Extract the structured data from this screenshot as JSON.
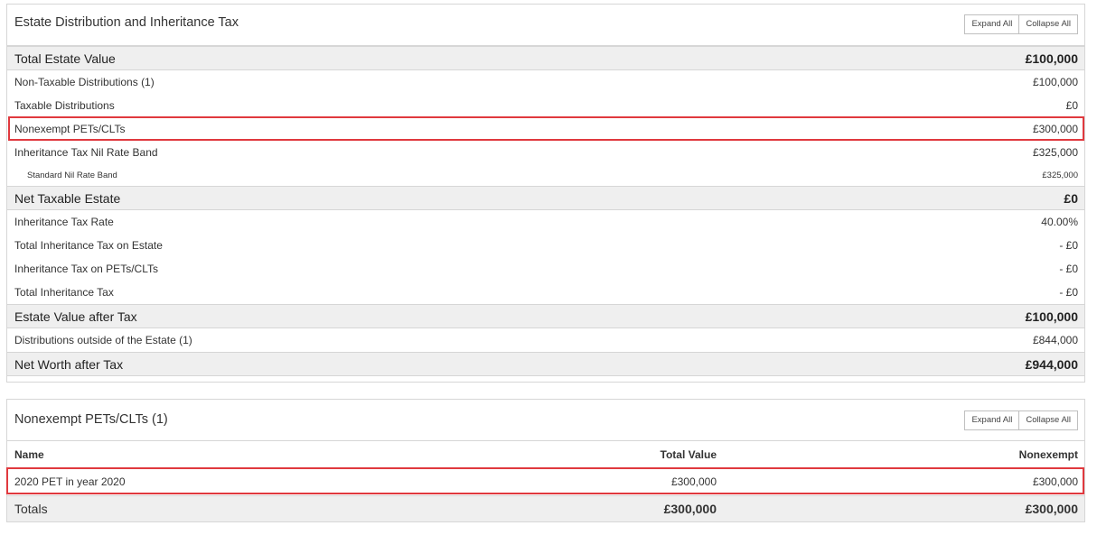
{
  "estate_panel": {
    "title": "Estate Distribution and Inheritance Tax",
    "expand_label": "Expand All",
    "collapse_label": "Collapse All",
    "rows": [
      {
        "label": "Total Estate Value",
        "value": "£100,000"
      },
      {
        "label": "Non-Taxable Distributions (1)",
        "value": "£100,000"
      },
      {
        "label": "Taxable Distributions",
        "value": "£0"
      },
      {
        "label": "Nonexempt PETs/CLTs",
        "value": "£300,000"
      },
      {
        "label": "Inheritance Tax Nil Rate Band",
        "value": "£325,000"
      },
      {
        "label": "Standard Nil Rate Band",
        "value": "£325,000"
      },
      {
        "label": "Net Taxable Estate",
        "value": "£0"
      },
      {
        "label": "Inheritance Tax Rate",
        "value": "40.00%"
      },
      {
        "label": "Total Inheritance Tax on Estate",
        "value": "- £0"
      },
      {
        "label": "Inheritance Tax on PETs/CLTs",
        "value": "- £0"
      },
      {
        "label": "Total Inheritance Tax",
        "value": "- £0"
      },
      {
        "label": "Estate Value after Tax",
        "value": "£100,000"
      },
      {
        "label": "Distributions outside of the Estate (1)",
        "value": "£844,000"
      },
      {
        "label": "Net Worth after Tax",
        "value": "£944,000"
      }
    ]
  },
  "pets_panel": {
    "title": "Nonexempt PETs/CLTs (1)",
    "expand_label": "Expand All",
    "collapse_label": "Collapse All",
    "columns": [
      "Name",
      "Total Value",
      "Nonexempt"
    ],
    "rows": [
      {
        "name": "2020 PET in year 2020",
        "total_value": "£300,000",
        "nonexempt": "£300,000"
      }
    ],
    "totals": {
      "label": "Totals",
      "total_value": "£300,000",
      "nonexempt": "£300,000"
    }
  },
  "highlight_color": "#e0393e"
}
